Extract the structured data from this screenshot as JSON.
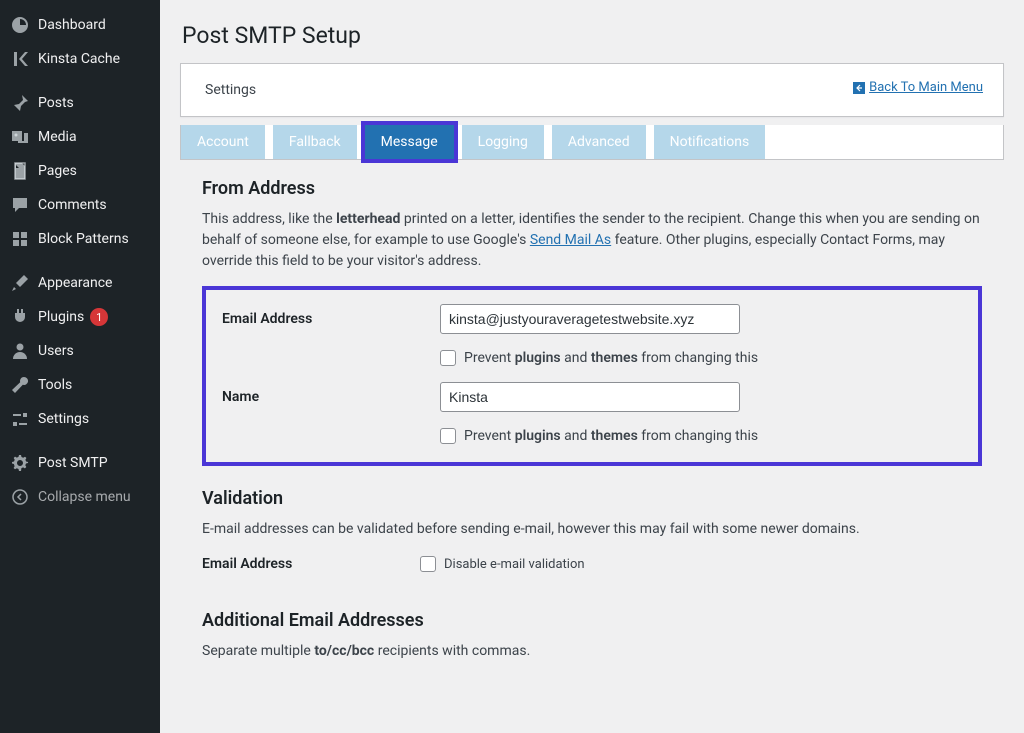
{
  "sidebar": {
    "items": [
      {
        "label": "Dashboard",
        "icon": "dashboard"
      },
      {
        "label": "Kinsta Cache",
        "icon": "kinsta"
      },
      {
        "label": "Posts",
        "icon": "pin"
      },
      {
        "label": "Media",
        "icon": "media"
      },
      {
        "label": "Pages",
        "icon": "page"
      },
      {
        "label": "Comments",
        "icon": "comment"
      },
      {
        "label": "Block Patterns",
        "icon": "blocks"
      },
      {
        "label": "Appearance",
        "icon": "brush"
      },
      {
        "label": "Plugins",
        "icon": "plug",
        "badge": "1"
      },
      {
        "label": "Users",
        "icon": "user"
      },
      {
        "label": "Tools",
        "icon": "wrench"
      },
      {
        "label": "Settings",
        "icon": "sliders"
      },
      {
        "label": "Post SMTP",
        "icon": "gear"
      }
    ],
    "collapse": "Collapse menu"
  },
  "page": {
    "title": "Post SMTP Setup",
    "settings_label": "Settings",
    "back_link": "Back To Main Menu"
  },
  "tabs": {
    "items": [
      "Account",
      "Fallback",
      "Message",
      "Logging",
      "Advanced",
      "Notifications"
    ],
    "active_index": 2
  },
  "from_address": {
    "heading": "From Address",
    "desc_prefix": "This address, like the ",
    "desc_bold1": "letterhead",
    "desc_mid1": " printed on a letter, identifies the sender to the recipient. Change this when you are sending on behalf of someone else, for example to use Google's ",
    "desc_link": "Send Mail As",
    "desc_tail": " feature. Other plugins, especially Contact Forms, may override this field to be your visitor's address.",
    "email_label": "Email Address",
    "email_value": "kinsta@justyouraveragetestwebsite.xyz",
    "prevent_prefix": "Prevent ",
    "prevent_b1": "plugins",
    "prevent_and": " and ",
    "prevent_b2": "themes",
    "prevent_suffix": " from changing this",
    "name_label": "Name",
    "name_value": "Kinsta"
  },
  "validation": {
    "heading": "Validation",
    "desc": "E-mail addresses can be validated before sending e-mail, however this may fail with some newer domains.",
    "email_label": "Email Address",
    "disable_label": "Disable e-mail validation"
  },
  "additional": {
    "heading": "Additional Email Addresses",
    "desc_prefix": "Separate multiple ",
    "desc_bold": "to/cc/bcc",
    "desc_suffix": " recipients with commas."
  }
}
